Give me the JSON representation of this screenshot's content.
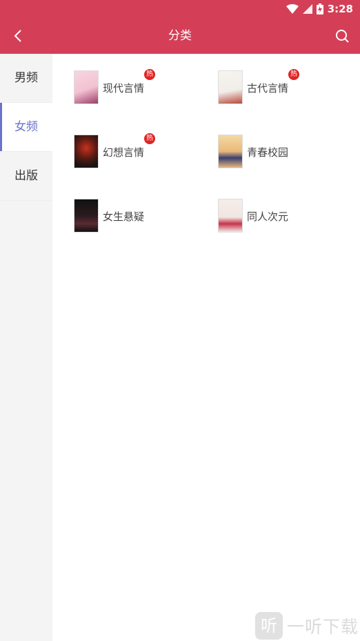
{
  "status_bar": {
    "time": "3:28"
  },
  "header": {
    "title": "分类"
  },
  "sidebar": {
    "items": [
      {
        "label": "男频"
      },
      {
        "label": "女频"
      },
      {
        "label": "出版"
      }
    ]
  },
  "categories": [
    {
      "label": "现代言情",
      "hot": "热",
      "cover": "cover-modern-romance",
      "colors": [
        "#f3c2d2",
        "#9c3c6a"
      ]
    },
    {
      "label": "古代言情",
      "hot": "热",
      "cover": "cover-ancient-romance",
      "colors": [
        "#f1ede8",
        "#b84a3a"
      ]
    },
    {
      "label": "幻想言情",
      "hot": "热",
      "cover": "cover-fantasy-romance",
      "colors": [
        "#1a1414",
        "#c6321f"
      ]
    },
    {
      "label": "青春校园",
      "hot": "",
      "cover": "cover-youth-campus",
      "colors": [
        "#e9b97a",
        "#3a3f72"
      ]
    },
    {
      "label": "女生悬疑",
      "hot": "",
      "cover": "cover-suspense",
      "colors": [
        "#111111",
        "#5a2a32"
      ]
    },
    {
      "label": "同人次元",
      "hot": "",
      "cover": "cover-fan-fiction",
      "colors": [
        "#f0e6e2",
        "#c8324a"
      ]
    }
  ],
  "watermark": {
    "logo": "听",
    "text": "一听下载"
  },
  "colors": {
    "accent": "#d43f57",
    "sidebar_active": "#6a72c9",
    "hot_badge": "#e02424"
  }
}
